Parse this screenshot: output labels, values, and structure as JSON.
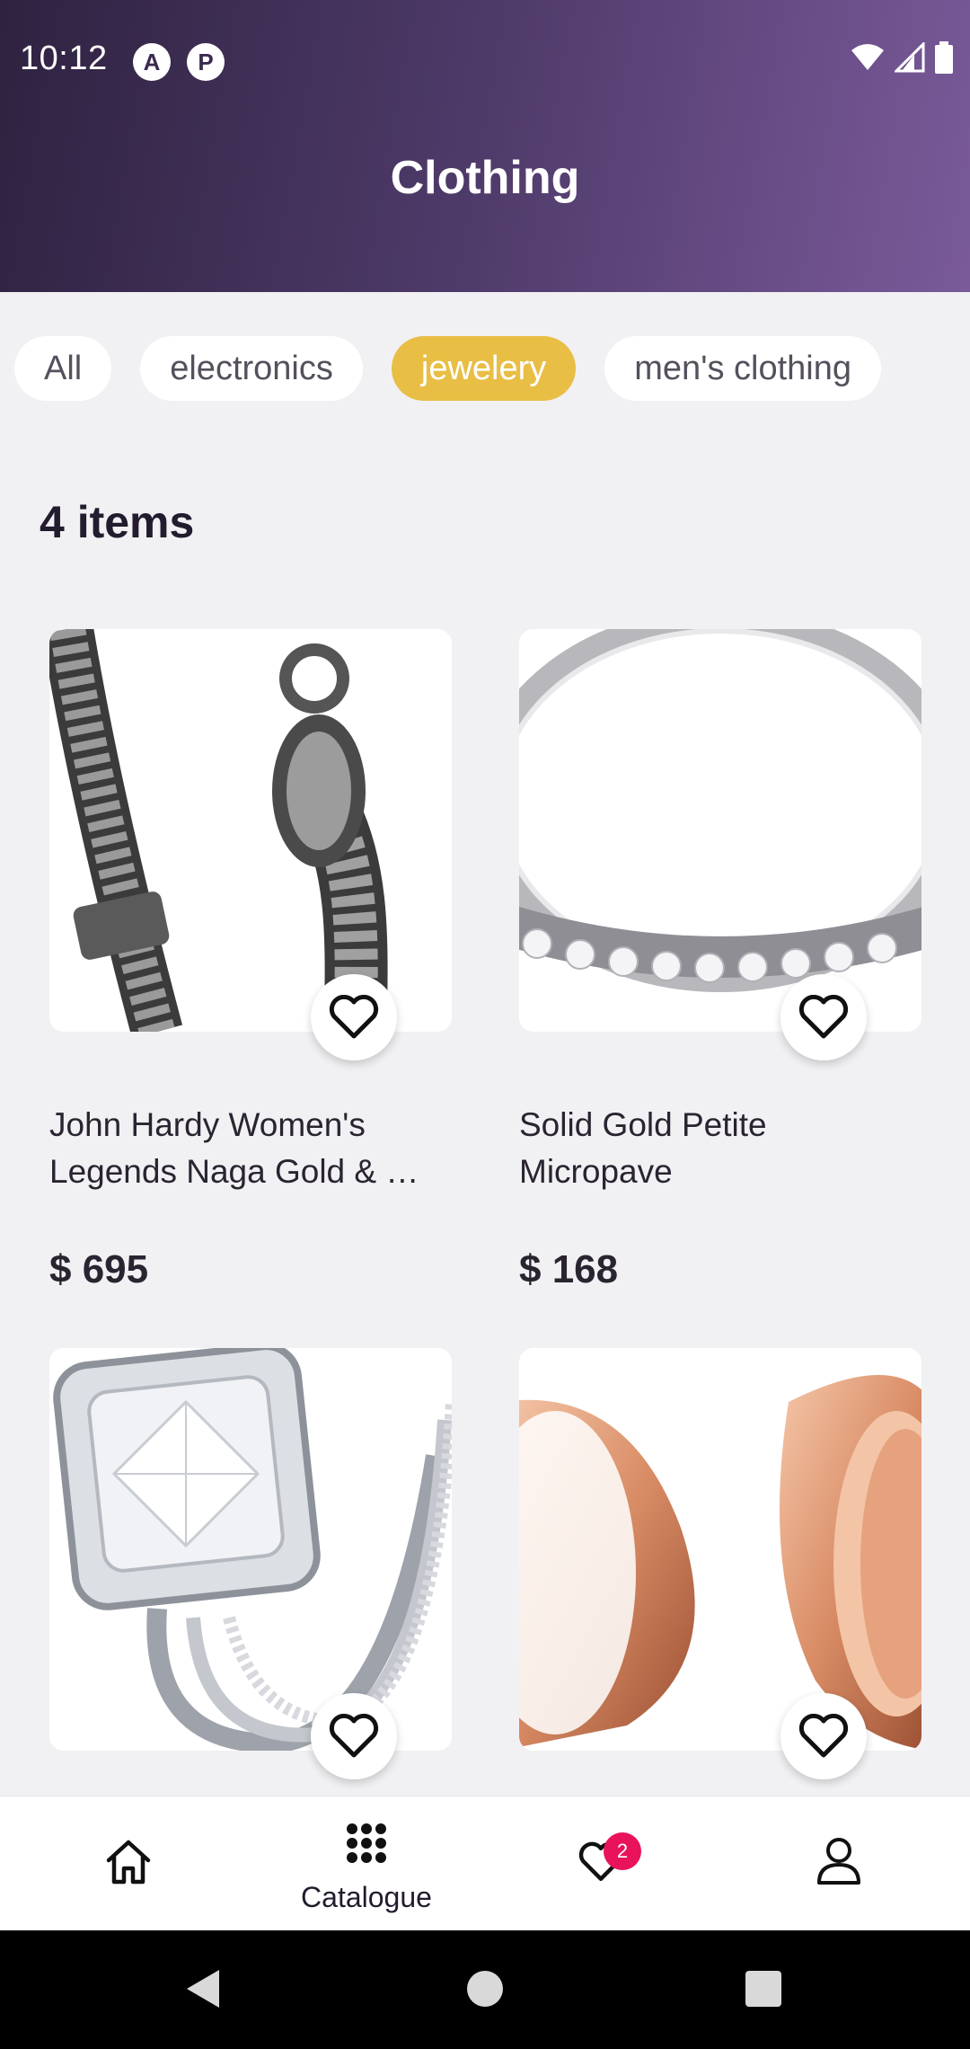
{
  "status_bar": {
    "time": "10:12",
    "app_icons": [
      "A",
      "P"
    ]
  },
  "header": {
    "title": "Clothing"
  },
  "categories": [
    {
      "label": "All",
      "active": false
    },
    {
      "label": "electronics",
      "active": false
    },
    {
      "label": "jewelery",
      "active": true
    },
    {
      "label": "men's clothing",
      "active": false
    }
  ],
  "items_count": "4 items",
  "products": [
    {
      "title": "John Hardy Women's Legends Naga Gold & …",
      "price": "$ 695",
      "image": "silver-chain-bracelet"
    },
    {
      "title": "Solid Gold Petite Micropave",
      "price": "$ 168",
      "image": "diamond-band-ring"
    },
    {
      "title": "",
      "price": "",
      "image": "halo-engagement-ring-set"
    },
    {
      "title": "",
      "price": "",
      "image": "rose-gold-tunnel-plugs"
    }
  ],
  "bottom_nav": {
    "items": [
      {
        "label": "",
        "icon": "home-icon"
      },
      {
        "label": "Catalogue",
        "icon": "grid-icon"
      },
      {
        "label": "",
        "icon": "heart-icon",
        "badge": "2"
      },
      {
        "label": "",
        "icon": "profile-icon"
      }
    ]
  },
  "colors": {
    "accent": "#e8be45",
    "badge": "#e8135a",
    "header_start": "#2e2240",
    "header_end": "#7a5a9a"
  }
}
